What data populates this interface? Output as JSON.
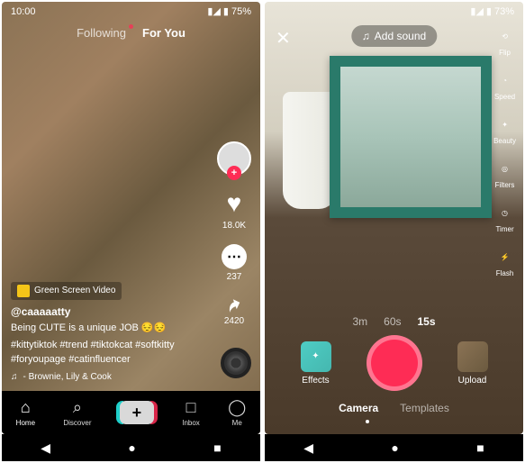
{
  "left": {
    "status": {
      "time": "10:00",
      "battery": "75%"
    },
    "tabs": {
      "following": "Following",
      "foryou": "For You"
    },
    "actions": {
      "likes": "18.0K",
      "comments": "237",
      "shares": "2420"
    },
    "green_screen": "Green Screen Video",
    "handle": "@caaaaatty",
    "caption1": "Being CUTE is a unique JOB 😔😔",
    "caption2": "#kittytiktok #trend #tiktokcat #softkitty #foryoupage #catinfluencer",
    "sound": "- Brownie, Lily & Cook",
    "nav": {
      "home": "Home",
      "discover": "Discover",
      "inbox": "Inbox",
      "me": "Me"
    }
  },
  "right": {
    "status": {
      "battery": "73%"
    },
    "add_sound": "Add sound",
    "tools": {
      "flip": "Flip",
      "speed": "Speed",
      "beauty": "Beauty",
      "filters": "Filters",
      "timer": "Timer",
      "flash": "Flash"
    },
    "durations": {
      "d3m": "3m",
      "d60s": "60s",
      "d15s": "15s"
    },
    "effects": "Effects",
    "upload": "Upload",
    "modes": {
      "camera": "Camera",
      "templates": "Templates"
    }
  }
}
